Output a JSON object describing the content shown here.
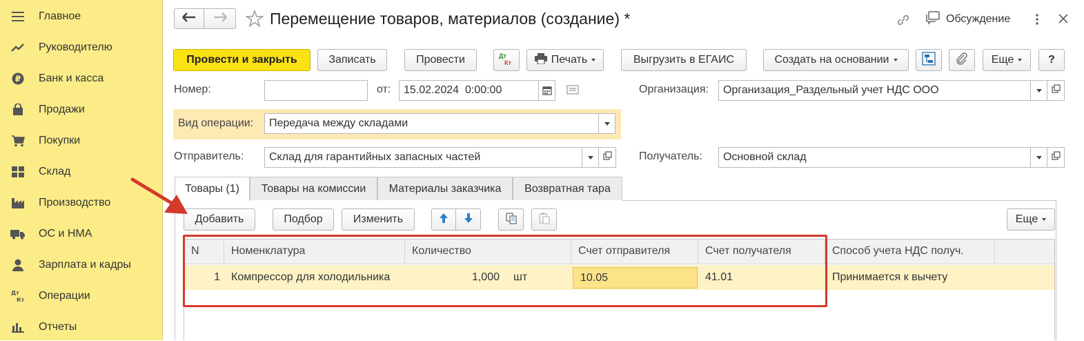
{
  "sidebar": {
    "items": [
      {
        "label": "Главное",
        "icon": "menu-icon"
      },
      {
        "label": "Руководителю",
        "icon": "trend-icon"
      },
      {
        "label": "Банк и касса",
        "icon": "ruble-icon"
      },
      {
        "label": "Продажи",
        "icon": "bag-icon"
      },
      {
        "label": "Покупки",
        "icon": "cart-icon"
      },
      {
        "label": "Склад",
        "icon": "warehouse-icon"
      },
      {
        "label": "Производство",
        "icon": "factory-icon"
      },
      {
        "label": "ОС и НМА",
        "icon": "truck-icon"
      },
      {
        "label": "Зарплата и кадры",
        "icon": "person-icon"
      },
      {
        "label": "Операции",
        "icon": "dt-kt-icon"
      },
      {
        "label": "Отчеты",
        "icon": "bar-chart-icon"
      }
    ]
  },
  "header": {
    "title": "Перемещение товаров, материалов (создание) *",
    "discussion": "Обсуждение"
  },
  "toolbar": {
    "post_close": "Провести и закрыть",
    "save": "Записать",
    "post": "Провести",
    "dtkt_top": "Дт",
    "dtkt_bottom": "Кт",
    "print": "Печать",
    "export": "Выгрузить в ЕГАИС",
    "create_based": "Создать на основании",
    "more": "Еще",
    "help": "?"
  },
  "form": {
    "number_label": "Номер:",
    "number_value": "",
    "date_label": "от:",
    "date_value": "15.02.2024  0:00:00",
    "org_label": "Организация:",
    "org_value": "Организация_Раздельный учет НДС ООО",
    "op_label": "Вид операции:",
    "op_value": "Передача между складами",
    "sender_label": "Отправитель:",
    "sender_value": "Склад для гарантийных запасных частей",
    "receiver_label": "Получатель:",
    "receiver_value": "Основной склад"
  },
  "tabs": [
    "Товары (1)",
    "Товары на комиссии",
    "Материалы заказчика",
    "Возвратная тара"
  ],
  "table_toolbar": {
    "add": "Добавить",
    "pick": "Подбор",
    "edit": "Изменить",
    "more": "Еще"
  },
  "table": {
    "headers": [
      "N",
      "Номенклатура",
      "Количество",
      "Счет отправителя",
      "Счет получателя",
      "Способ учета НДС получ."
    ],
    "rows": [
      {
        "n": "1",
        "item": "Компрессор для холодильника",
        "qty": "1,000",
        "unit": "шт",
        "sender_acc": "10.05",
        "receiver_acc": "41.01",
        "vat": "Принимается к вычету"
      }
    ]
  },
  "colors": {
    "sidebar_bg": "#fbec88",
    "primary_button": "#fbe214",
    "highlight": "#fdf3c6",
    "annotation_red": "#d33a2c"
  }
}
